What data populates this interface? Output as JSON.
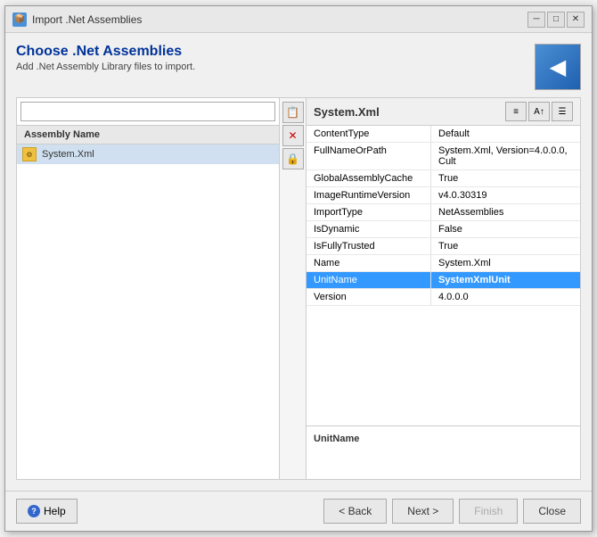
{
  "window": {
    "title": "Import .Net Assemblies",
    "title_icon": "📦",
    "controls": {
      "minimize": "─",
      "maximize": "□",
      "close": "✕"
    }
  },
  "header": {
    "title": "Choose .Net Assemblies",
    "subtitle": "Add .Net Assembly Library files to import.",
    "icon_arrow": "◀"
  },
  "left_panel": {
    "search_placeholder": "",
    "column_header": "Assembly Name",
    "items": [
      {
        "name": "System.Xml",
        "selected": true
      }
    ]
  },
  "toolbar": {
    "add_btn": "📋",
    "remove_btn": "✕",
    "edit_btn": "🔒"
  },
  "right_panel": {
    "title": "System.Xml",
    "toolbar_btns": [
      "≡",
      "A↑",
      "☰"
    ],
    "properties": [
      {
        "name": "ContentType",
        "value": "Default",
        "selected": false
      },
      {
        "name": "FullNameOrPath",
        "value": "System.Xml, Version=4.0.0.0, Cult",
        "selected": false
      },
      {
        "name": "GlobalAssemblyCache",
        "value": "True",
        "selected": false
      },
      {
        "name": "ImageRuntimeVersion",
        "value": "v4.0.30319",
        "selected": false
      },
      {
        "name": "ImportType",
        "value": "NetAssemblies",
        "selected": false
      },
      {
        "name": "IsDynamic",
        "value": "False",
        "selected": false
      },
      {
        "name": "IsFullyTrusted",
        "value": "True",
        "selected": false
      },
      {
        "name": "Name",
        "value": "System.Xml",
        "selected": false
      },
      {
        "name": "UnitName",
        "value": "SystemXmlUnit",
        "selected": true
      },
      {
        "name": "Version",
        "value": "4.0.0.0",
        "selected": false
      }
    ],
    "description": {
      "title": "UnitName",
      "text": ""
    }
  },
  "footer": {
    "help_label": "Help",
    "back_label": "< Back",
    "next_label": "Next >",
    "finish_label": "Finish",
    "close_label": "Close"
  }
}
